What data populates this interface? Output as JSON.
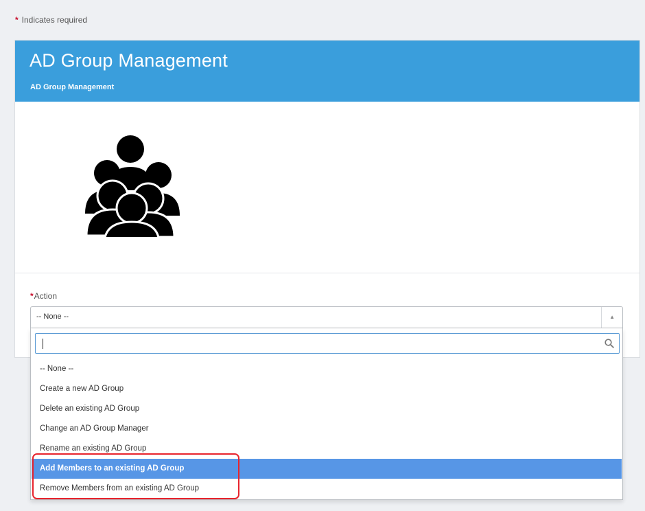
{
  "required_note": {
    "star": "*",
    "text": "Indicates required"
  },
  "card": {
    "title": "AD Group Management",
    "subtitle": "AD Group Management",
    "header_color": "#3a9edc",
    "image_icon": "users-group-icon"
  },
  "action_field": {
    "star": "*",
    "label": "Action",
    "selected_value": "-- None --",
    "arrow": "▲"
  },
  "dropdown": {
    "search_value": "",
    "search_icon": "search-icon",
    "options": [
      {
        "label": "-- None --",
        "highlighted": false
      },
      {
        "label": "Create a new AD Group",
        "highlighted": false
      },
      {
        "label": "Delete an existing AD Group",
        "highlighted": false
      },
      {
        "label": "Change an AD Group Manager",
        "highlighted": false
      },
      {
        "label": "Rename an existing AD Group",
        "highlighted": false
      },
      {
        "label": "Add Members to an existing AD Group",
        "highlighted": true
      },
      {
        "label": "Remove Members from an existing AD Group",
        "highlighted": false
      }
    ],
    "highlight_color": "#5796e6"
  },
  "annotation": {
    "color": "#e8242d"
  }
}
